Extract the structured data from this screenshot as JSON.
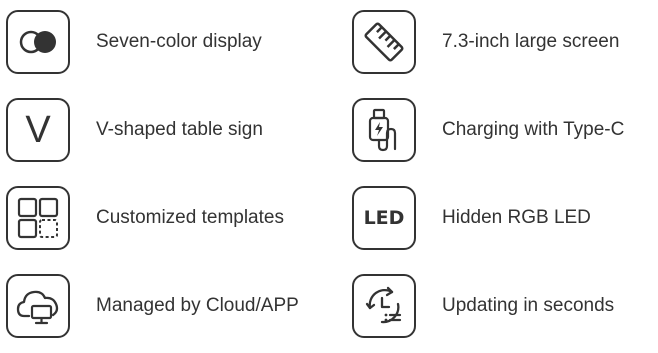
{
  "features": {
    "seven_color": {
      "label": "Seven-color display",
      "icon": "toggle-circles-icon"
    },
    "large_screen": {
      "label": "7.3-inch large screen",
      "icon": "ruler-icon"
    },
    "v_shaped": {
      "label": "V-shaped table sign",
      "icon": "v-letter-icon",
      "icon_text": "V"
    },
    "type_c": {
      "label": "Charging with Type-C",
      "icon": "usb-c-cable-icon"
    },
    "templates": {
      "label": "Customized templates",
      "icon": "template-grid-icon"
    },
    "rgb_led": {
      "label": "Hidden RGB LED",
      "icon": "led-text-icon",
      "icon_text": "LED"
    },
    "cloud_app": {
      "label": "Managed by Cloud/APP",
      "icon": "cloud-monitor-icon"
    },
    "updating": {
      "label": "Updating in seconds",
      "icon": "refresh-clock-icon"
    }
  },
  "colors": {
    "text": "#333333",
    "background": "#ffffff"
  }
}
